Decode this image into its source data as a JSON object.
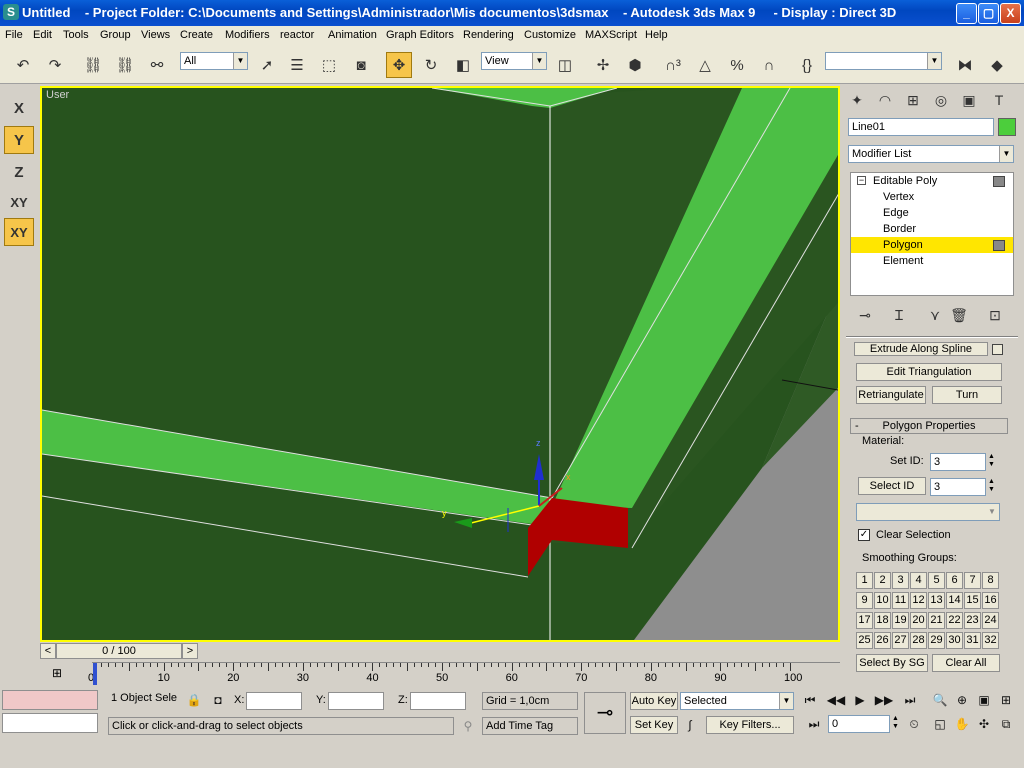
{
  "window": {
    "title": "Untitled    - Project Folder: C:\\Documents and Settings\\Administrador\\Mis documentos\\3dsmax    - Autodesk 3ds Max 9     - Display : Direct 3D",
    "minimize": "_",
    "maximize": "▢",
    "close": "X"
  },
  "menu": [
    "File",
    "Edit",
    "Tools",
    "Group",
    "Views",
    "Create",
    "Modifiers",
    "reactor",
    "Animation",
    "Graph Editors",
    "Rendering",
    "Customize",
    "MAXScript",
    "Help"
  ],
  "toolbar": {
    "selection_filter": "All",
    "ref_coord": "View",
    "named_selection": ""
  },
  "axis_constraints": [
    "X",
    "Y",
    "Z",
    "XY",
    "XY"
  ],
  "viewport": {
    "label": "User",
    "gizmo_z": "z",
    "gizmo_x": "x",
    "gizmo_y": "y"
  },
  "command_panel": {
    "object_name": "Line01",
    "object_color": "#4cce3c",
    "modifier_list": "Modifier List",
    "stack": [
      {
        "label": "Editable Poly",
        "type": "root"
      },
      {
        "label": "Vertex",
        "type": "sub"
      },
      {
        "label": "Edge",
        "type": "sub"
      },
      {
        "label": "Border",
        "type": "sub"
      },
      {
        "label": "Polygon",
        "type": "sub",
        "selected": true
      },
      {
        "label": "Element",
        "type": "sub"
      }
    ],
    "extrude_along_spline": "Extrude Along Spline",
    "edit_triangulation": "Edit Triangulation",
    "retriangulate": "Retriangulate",
    "turn": "Turn",
    "rollout_title": "Polygon Properties",
    "rollout_toggle": "-",
    "material_label": "Material:",
    "set_id_label": "Set ID:",
    "set_id_value": "3",
    "select_id_button": "Select ID",
    "select_id_value": "3",
    "material_dropdown": "",
    "clear_selection": "Clear Selection",
    "smoothing_groups_label": "Smoothing Groups:",
    "smoothing_groups": [
      "1",
      "2",
      "3",
      "4",
      "5",
      "6",
      "7",
      "8",
      "9",
      "10",
      "11",
      "12",
      "13",
      "14",
      "15",
      "16",
      "17",
      "18",
      "19",
      "20",
      "21",
      "22",
      "23",
      "24",
      "25",
      "26",
      "27",
      "28",
      "29",
      "30",
      "31",
      "32"
    ],
    "select_by_sg": "Select By SG",
    "clear_all": "Clear All"
  },
  "timeline": {
    "frame_counter": "0 / 100",
    "prev": "<",
    "next": ">",
    "ticks": [
      "0",
      "10",
      "20",
      "30",
      "40",
      "50",
      "60",
      "70",
      "80",
      "90",
      "100"
    ]
  },
  "status": {
    "selection_count": "1 Object Sele",
    "x_label": "X:",
    "y_label": "Y:",
    "z_label": "Z:",
    "x_value": "",
    "y_value": "",
    "z_value": "",
    "grid": "Grid = 1,0cm",
    "prompt": "Click or click-and-drag to select objects",
    "add_time_tag": "Add Time Tag",
    "auto_key": "Auto Key",
    "set_key": "Set Key",
    "key_mode": "Selected",
    "key_filters": "Key Filters...",
    "current_frame": "0"
  }
}
